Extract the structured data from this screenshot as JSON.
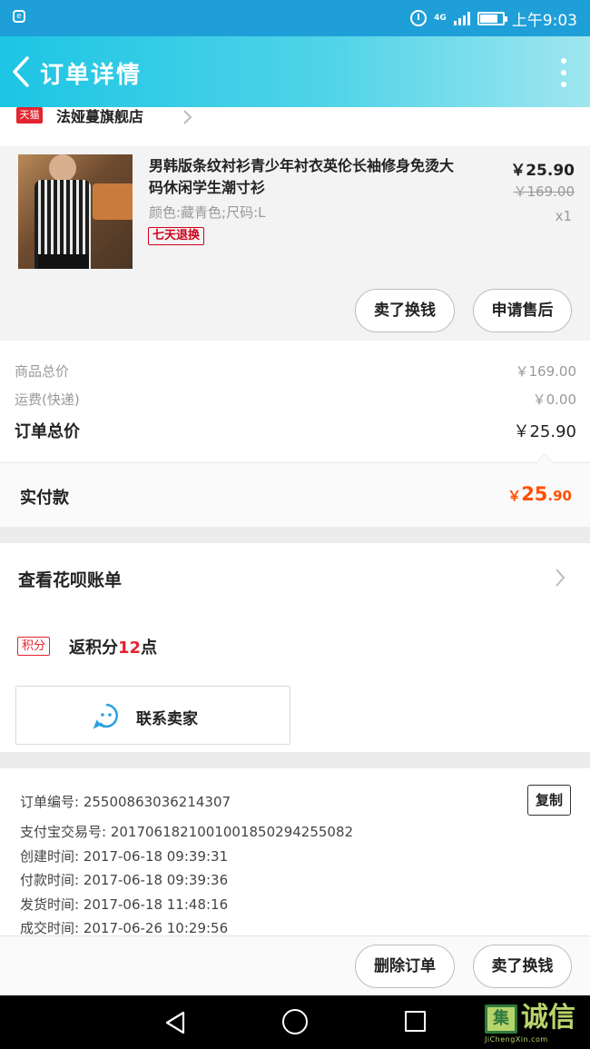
{
  "status_bar": {
    "network": "4G",
    "time": "上午9:03"
  },
  "header": {
    "title": "订单详情"
  },
  "shop": {
    "badge": "天猫",
    "name": "法娅蔓旗舰店"
  },
  "product": {
    "title": "男韩版条纹衬衫青少年衬衣英伦长袖修身免烫大码休闲学生潮寸衫",
    "sku": "颜色:藏青色;尺码:L",
    "tag": "七天退换",
    "price": "￥25.90",
    "original_price": "￥169.00",
    "quantity": "x1",
    "actions": {
      "sell": "卖了换钱",
      "after_sale": "申请售后"
    }
  },
  "summary": {
    "goods_total_label": "商品总价",
    "goods_total_value": "￥169.00",
    "shipping_label": "运费(快递)",
    "shipping_value": "￥0.00",
    "order_total_label": "订单总价",
    "order_total_value": "￥25.90",
    "paid_label": "实付款",
    "paid_currency": "￥",
    "paid_integer": "25",
    "paid_decimal": ".90"
  },
  "huabei": {
    "label": "查看花呗账单"
  },
  "points": {
    "tag": "积分",
    "prefix": "返积分",
    "amount": "12",
    "suffix": "点"
  },
  "contact": {
    "label": "联系卖家"
  },
  "order_info": {
    "copy_label": "复制",
    "order_no": "订单编号: 25500863036214307",
    "alipay_no": "支付宝交易号: 2017061821001001850294255082",
    "created": "创建时间: 2017-06-18 09:39:31",
    "paid": "付款时间: 2017-06-18 09:39:36",
    "shipped": "发货时间: 2017-06-18 11:48:16",
    "completed": "成交时间: 2017-06-26 10:29:56"
  },
  "bottom_bar": {
    "delete": "删除订单",
    "sell": "卖了换钱"
  },
  "watermark": {
    "box": "集",
    "text": "诚信",
    "sub": "JiChengXin.com"
  },
  "colors": {
    "header_start": "#1dc5e4",
    "header_end": "#9fe6ef",
    "paid_orange": "#ff5000",
    "tmall_red": "#e4242f"
  }
}
